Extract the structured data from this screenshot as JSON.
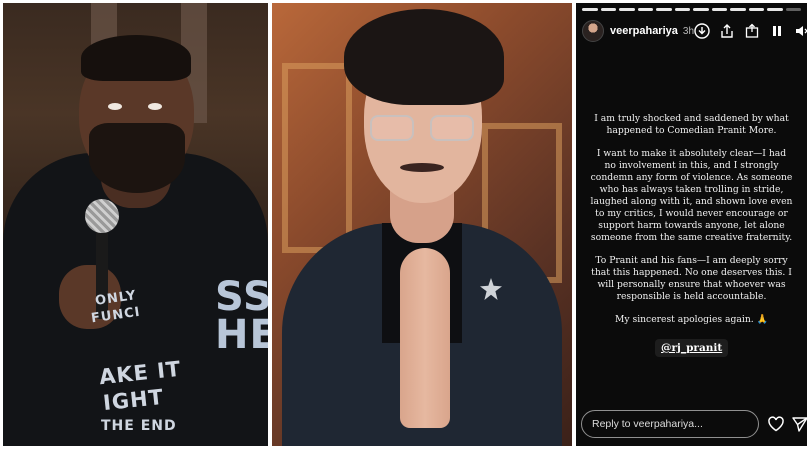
{
  "story": {
    "username": "veerpahariya",
    "time": "3h",
    "segments_total": 12,
    "segments_seen": 11,
    "paragraphs": [
      "I am truly shocked and saddened by what happened to Comedian Pranit More.",
      "I want to make it absolutely clear—I had no involvement in this, and I strongly condemn any form of violence. As someone who has always taken trolling in stride, laughed along with it, and shown love even to my critics, I would never encourage or support harm towards anyone, let alone someone from the same creative fraternity.",
      "To Pranit and his fans—I am deeply sorry that this happened. No one deserves this. I will personally ensure that whoever was responsible is held accountable.",
      "My sincerest apologies again. 🙏"
    ],
    "mention": "@rj_pranit",
    "reply_placeholder": "Reply to veerpahariya...",
    "icons": {
      "download": "download-icon",
      "share": "share-icon",
      "pause": "pause-icon",
      "mute": "mute-icon",
      "heart": "heart-icon",
      "send": "send-icon"
    }
  },
  "left_photo": {
    "hoodie_text": [
      "ONLY",
      "FUNCI",
      "AKE IT",
      "IGHT",
      "THE END",
      "SS",
      "HE"
    ]
  },
  "colors": {
    "story_bg": "#0b0b0b",
    "text": "#f2f2f2"
  }
}
